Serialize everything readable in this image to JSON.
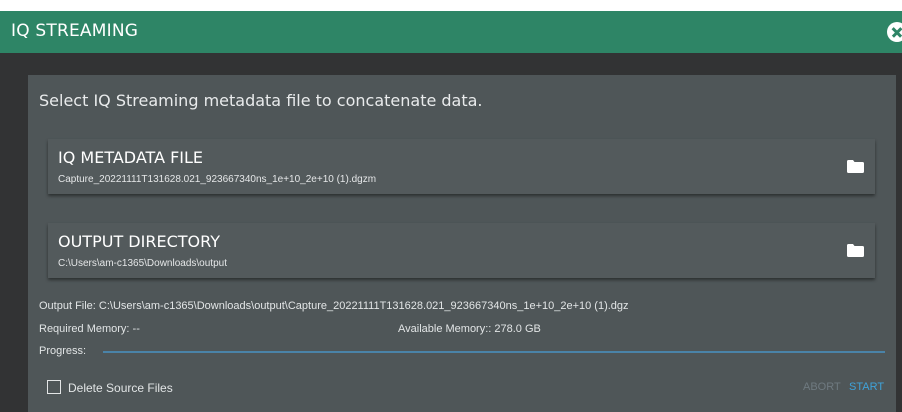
{
  "dialog": {
    "title": "IQ STREAMING"
  },
  "prompt": "Select IQ Streaming metadata file to concatenate data.",
  "metadata_file": {
    "label": "IQ METADATA FILE",
    "value": "Capture_20221111T131628.021_923667340ns_1e+10_2e+10 (1).dgzm",
    "icon": "folder-icon"
  },
  "output_directory": {
    "label": "OUTPUT DIRECTORY",
    "value": "C:\\Users\\am-c1365\\Downloads\\output",
    "icon": "folder-icon"
  },
  "info": {
    "output_file": "Output File: C:\\Users\\am-c1365\\Downloads\\output\\Capture_20221111T131628.021_923667340ns_1e+10_2e+10 (1).dgz",
    "required_memory": "Required Memory: --",
    "available_memory": "Available Memory:: 278.0 GB",
    "progress_label": "Progress:",
    "progress": 0
  },
  "options": {
    "delete_source_label": "Delete Source Files",
    "delete_source_checked": false
  },
  "actions": {
    "abort": "ABORT",
    "start": "START"
  },
  "colors": {
    "title_bar": "#2e8566",
    "panel": "#4f5658",
    "progress_track": "#4a83a8",
    "start_accent": "#3fa3da",
    "abort_disabled": "#6f7a80"
  }
}
